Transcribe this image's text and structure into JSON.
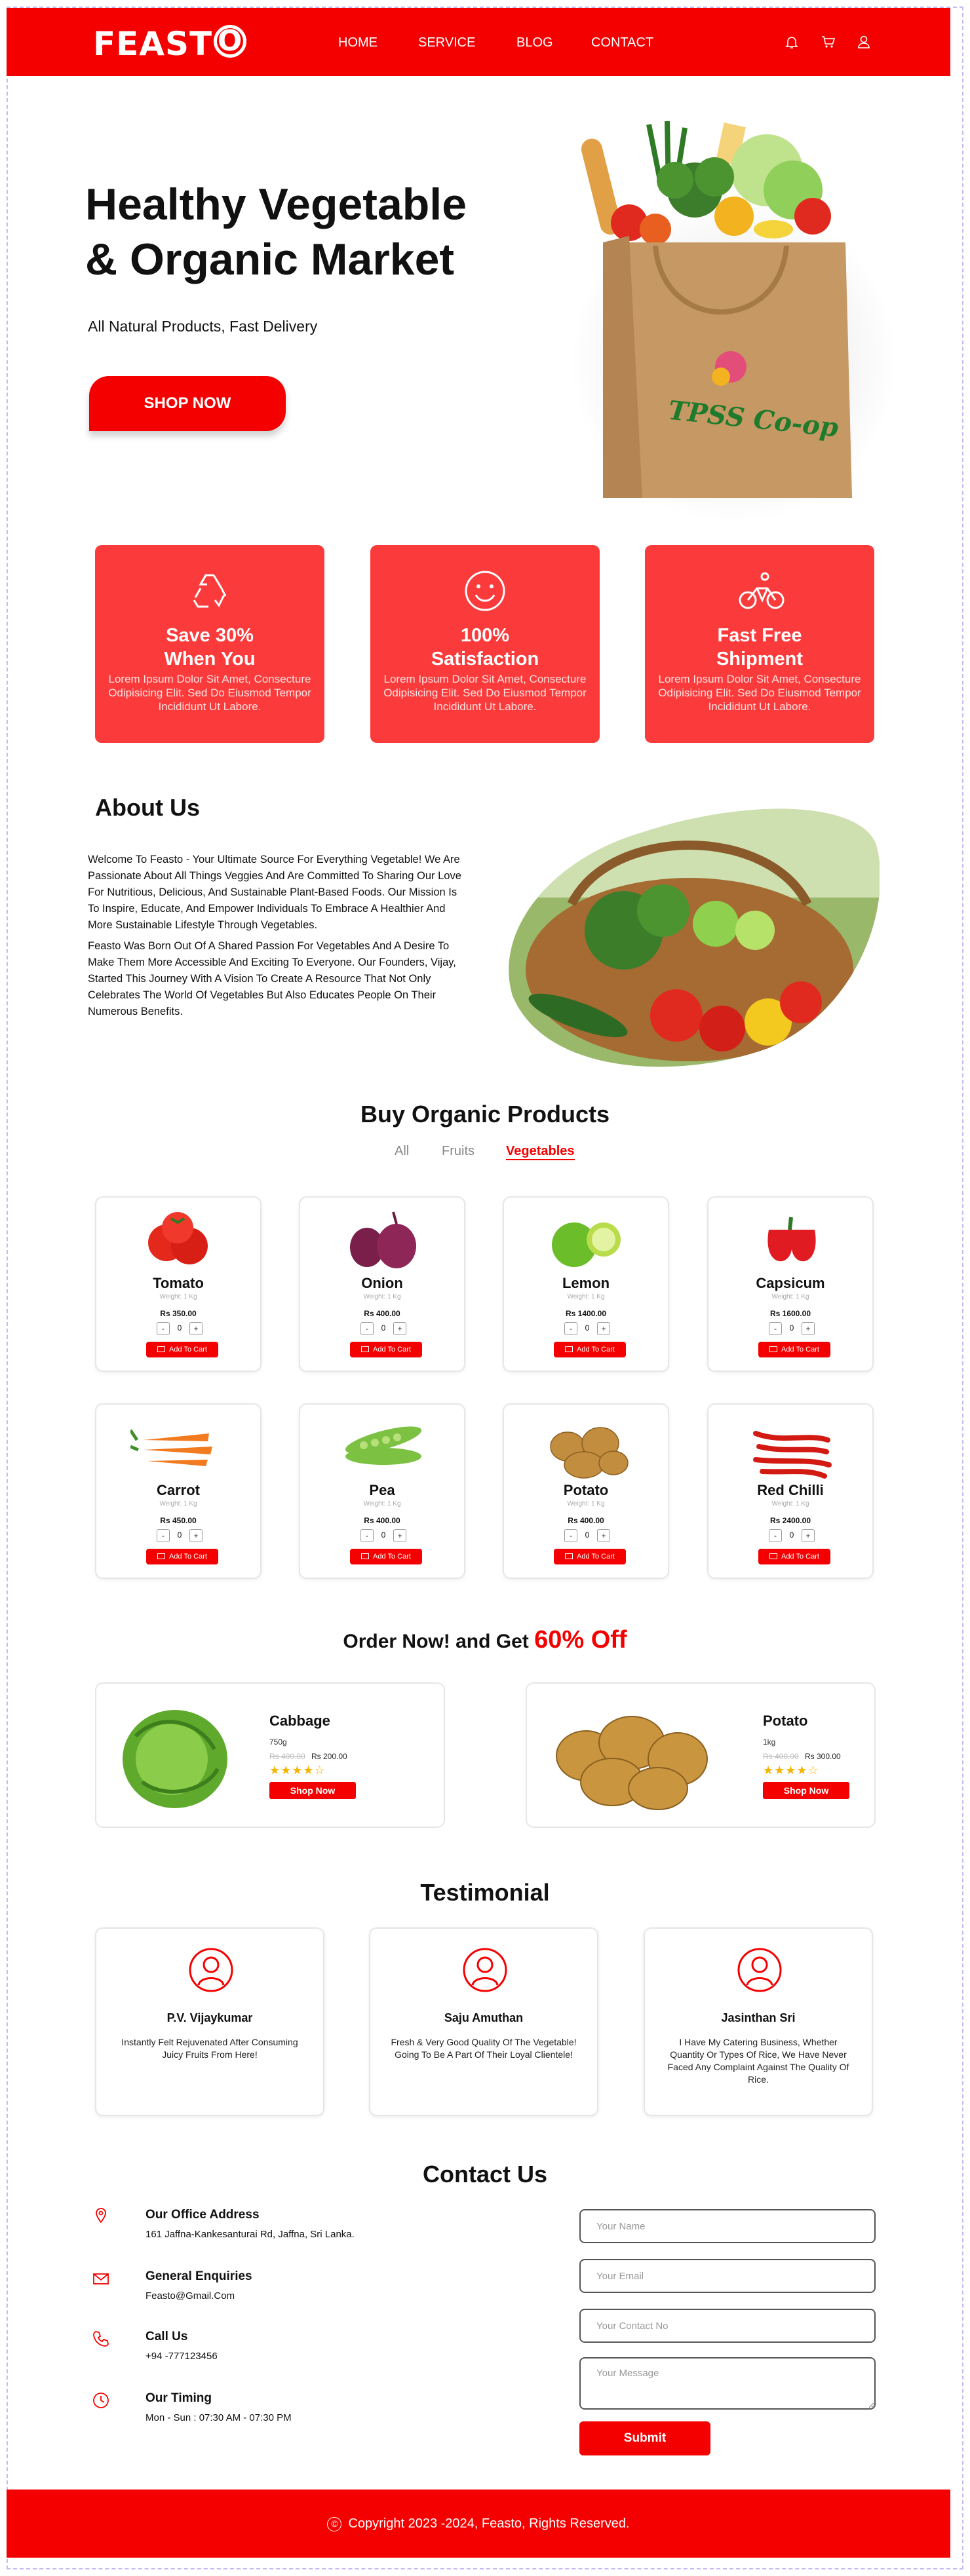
{
  "brand": {
    "logo": "FEAST",
    "logo_o": "O"
  },
  "nav": {
    "home": "HOME",
    "service": "SERVICE",
    "blog": "BLOG",
    "contact": "CONTACT"
  },
  "header_icons": [
    "bell-icon",
    "cart-icon",
    "user-icon"
  ],
  "hero": {
    "title_line1": "Healthy Vegetable",
    "title_line2": "& Organic Market",
    "subtitle": "All Natural Products, Fast Delivery",
    "cta": "SHOP NOW",
    "bag_label": "TPSS Co-op"
  },
  "features": [
    {
      "icon": "recycle-icon",
      "title_l1": "Save 30%",
      "title_l2": "When You",
      "text": "Lorem Ipsum  Dolor Sit Amet, Consecture Odipisicing Elit. Sed Do Eiusmod Tempor Incididunt Ut Labore."
    },
    {
      "icon": "smile-icon",
      "title_l1": "100%",
      "title_l2": "Satisfaction",
      "text": "Lorem Ipsum  Dolor Sit Amet, Consecture Odipisicing Elit. Sed Do Eiusmod Tempor Incididunt Ut Labore."
    },
    {
      "icon": "bicycle-icon",
      "title_l1": "Fast Free",
      "title_l2": "Shipment",
      "text": "Lorem Ipsum  Dolor Sit Amet, Consecture Odipisicing Elit. Sed Do Eiusmod Tempor Incididunt Ut Labore."
    }
  ],
  "about": {
    "title": "About Us",
    "p1": "Welcome To Feasto - Your Ultimate Source For Everything Vegetable! We Are Passionate About All Things Veggies And Are Committed To Sharing Our Love For Nutritious, Delicious, And Sustainable Plant-Based Foods. Our Mission Is To Inspire, Educate, And Empower Individuals To Embrace A Healthier And More Sustainable Lifestyle Through Vegetables.",
    "p2": "Feasto Was Born Out Of A Shared Passion For Vegetables And A Desire To Make Them More Accessible And Exciting To Everyone. Our Founders, Vijay, Started This Journey With A Vision To Create A Resource That Not Only Celebrates The World Of Vegetables But Also Educates People On Their Numerous Benefits."
  },
  "products": {
    "title": "Buy Organic Products",
    "tabs": [
      "All",
      "Fruits",
      "Vegetables"
    ],
    "active_tab": "Vegetables",
    "add_label": "Add To Cart",
    "minus": "-",
    "plus": "+",
    "items": [
      {
        "name": "Tomato",
        "weight": "Weight: 1 Kg",
        "price": "Rs 350.00",
        "qty": "0"
      },
      {
        "name": "Onion",
        "weight": "Weight: 1 Kg",
        "price": "Rs 400.00",
        "qty": "0"
      },
      {
        "name": "Lemon",
        "weight": "Weight: 1 Kg",
        "price": "Rs 1400.00",
        "qty": "0"
      },
      {
        "name": "Capsicum",
        "weight": "Weight: 1 Kg",
        "price": "Rs 1600.00",
        "qty": "0"
      },
      {
        "name": "Carrot",
        "weight": "Weight: 1 Kg",
        "price": "Rs 450.00",
        "qty": "0"
      },
      {
        "name": "Pea",
        "weight": "Weight: 1 Kg",
        "price": "Rs 400.00",
        "qty": "0"
      },
      {
        "name": "Potato",
        "weight": "Weight: 1 Kg",
        "price": "Rs 400.00",
        "qty": "0"
      },
      {
        "name": "Red Chilli",
        "weight": "Weight: 1 Kg",
        "price": "Rs 2400.00",
        "qty": "0"
      }
    ]
  },
  "offer": {
    "title_prefix": "Order Now! and Get ",
    "title_highlight": "60% Off",
    "items": [
      {
        "name": "Cabbage",
        "weight": "750g",
        "old_price": "Rs 400.00",
        "price": "Rs 200.00",
        "stars": "★★★★☆",
        "rating": 4,
        "cta": "Shop Now"
      },
      {
        "name": "Potato",
        "weight": "1kg",
        "old_price": "Rs 400.00",
        "price": "Rs 300.00",
        "stars": "★★★★☆",
        "rating": 4,
        "cta": "Shop Now"
      }
    ]
  },
  "testimonial": {
    "title": "Testimonial",
    "items": [
      {
        "name": "P.V. Vijaykumar",
        "text": "Instantly Felt Rejuvenated After Consuming Juicy Fruits From Here!"
      },
      {
        "name": "Saju Amuthan",
        "text": "Fresh & Very Good Quality Of The Vegetable! Going To Be A Part Of Their Loyal Clientele!"
      },
      {
        "name": "Jasinthan Sri",
        "text": "I Have My Catering Business, Whether Quantity Or Types Of Rice, We Have Never Faced Any Complaint Against The Quality Of Rice."
      }
    ]
  },
  "contact": {
    "title": "Contact Us",
    "office_title": "Our Office Address",
    "office_value": "161 Jaffna-Kankesanturai Rd, Jaffna, Sri Lanka.",
    "enq_title": "General Enquiries",
    "enq_value": "Feasto@Gmail.Com",
    "call_title": "Call Us",
    "call_value": "+94 -777123456",
    "timing_title": "Our Timing",
    "timing_value": "Mon - Sun : 07:30 AM - 07:30 PM",
    "form": {
      "name_placeholder": "Your Name",
      "email_placeholder": "Your Email",
      "contact_placeholder": "Your Contact No",
      "message_placeholder": "Your Message",
      "submit": "Submit"
    }
  },
  "footer": {
    "copyright_symbol": "©",
    "text": "Copyright 2023 -2024, Feasto, Rights Reserved."
  },
  "colors": {
    "brand": "#f40000",
    "feature_card": "#fb3b3b",
    "star": "#f4b400"
  }
}
